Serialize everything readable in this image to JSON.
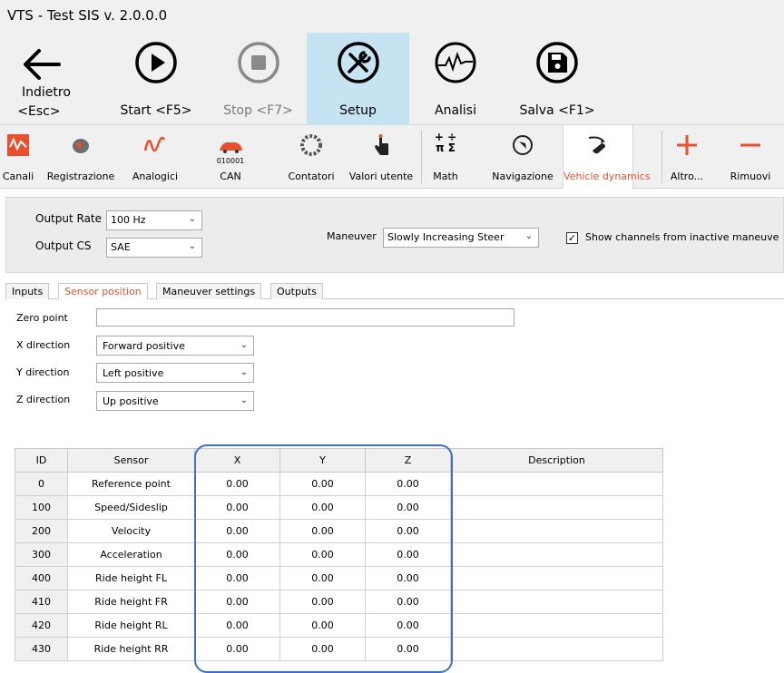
{
  "window": {
    "title": "VTS - Test SIS v. 2.0.0.0"
  },
  "toolbar": {
    "back": {
      "line1": "Indietro",
      "line2": "<Esc>"
    },
    "start": "Start <F5>",
    "stop": "Stop <F7>",
    "setup": "Setup",
    "analisi": "Analisi",
    "salva": "Salva <F1>"
  },
  "ribbon": {
    "canali": "Canali",
    "registrazione": "Registrazione",
    "analogici": "Analogici",
    "can": "CAN",
    "can_sub": "010001",
    "contatori": "Contatori",
    "valori_utente": "Valori utente",
    "math": "Math",
    "math_symbols": "+ ÷\nπ Σ",
    "navigazione": "Navigazione",
    "vehicle_dynamics": "Vehicle dynamics",
    "altro": "Altro...",
    "rimuovi": "Rimuovi"
  },
  "settings": {
    "output_rate_label": "Output Rate",
    "output_rate_value": "100 Hz",
    "output_cs_label": "Output CS",
    "output_cs_value": "SAE",
    "maneuver_label": "Maneuver",
    "maneuver_value": "Slowly Increasing Steer",
    "show_inactive_label": "Show channels from inactive maneuve"
  },
  "tabs": [
    "Inputs",
    "Sensor position",
    "Maneuver settings",
    "Outputs"
  ],
  "sensor_position": {
    "zero_point_label": "Zero point",
    "zero_point_value": "",
    "x_direction_label": "X direction",
    "x_direction_value": "Forward positive",
    "y_direction_label": "Y direction",
    "y_direction_value": "Left positive",
    "z_direction_label": "Z direction",
    "z_direction_value": "Up positive"
  },
  "table": {
    "headers": [
      "ID",
      "Sensor",
      "X",
      "Y",
      "Z",
      "Description"
    ],
    "rows": [
      [
        "0",
        "Reference point",
        "0.00",
        "0.00",
        "0.00",
        ""
      ],
      [
        "100",
        "Speed/Sideslip",
        "0.00",
        "0.00",
        "0.00",
        ""
      ],
      [
        "200",
        "Velocity",
        "0.00",
        "0.00",
        "0.00",
        ""
      ],
      [
        "300",
        "Acceleration",
        "0.00",
        "0.00",
        "0.00",
        ""
      ],
      [
        "400",
        "Ride height FL",
        "0.00",
        "0.00",
        "0.00",
        ""
      ],
      [
        "410",
        "Ride height FR",
        "0.00",
        "0.00",
        "0.00",
        ""
      ],
      [
        "420",
        "Ride height RL",
        "0.00",
        "0.00",
        "0.00",
        ""
      ],
      [
        "430",
        "Ride height RR",
        "0.00",
        "0.00",
        "0.00",
        ""
      ]
    ]
  },
  "colors": {
    "accent": "#e8512d",
    "active_toolbar": "#c6e3f2",
    "highlight": "#3d6fc9"
  }
}
